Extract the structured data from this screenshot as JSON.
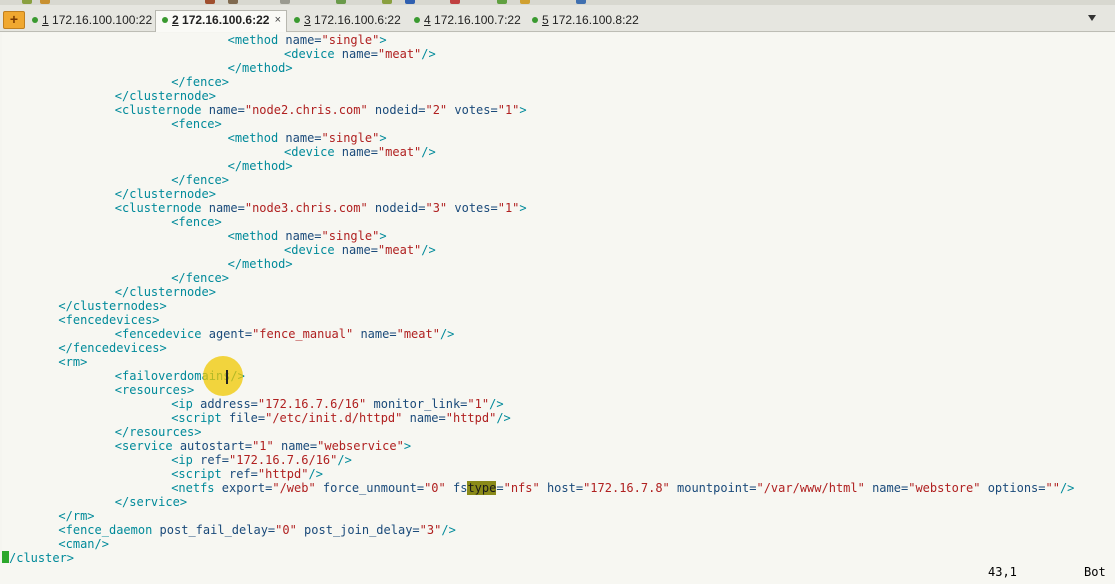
{
  "tabs": [
    {
      "num": "1",
      "host": "172.16.100.100:22"
    },
    {
      "num": "2",
      "host": "172.16.100.6:22"
    },
    {
      "num": "3",
      "host": "172.16.100.6:22"
    },
    {
      "num": "4",
      "host": "172.16.100.7:22"
    },
    {
      "num": "5",
      "host": "172.16.100.8:22"
    }
  ],
  "tab_close_glyph": "×",
  "tab_add_glyph": "+",
  "lines": [
    {
      "indent": 32,
      "parts": [
        [
          "t",
          "<method "
        ],
        [
          "a",
          "name="
        ],
        [
          "v",
          "\"single\""
        ],
        [
          "t",
          ">"
        ]
      ]
    },
    {
      "indent": 40,
      "parts": [
        [
          "t",
          "<device "
        ],
        [
          "a",
          "name="
        ],
        [
          "v",
          "\"meat\""
        ],
        [
          "t",
          "/>"
        ]
      ]
    },
    {
      "indent": 32,
      "parts": [
        [
          "t",
          "</method>"
        ]
      ]
    },
    {
      "indent": 24,
      "parts": [
        [
          "t",
          "</fence>"
        ]
      ]
    },
    {
      "indent": 16,
      "parts": [
        [
          "t",
          "</clusternode>"
        ]
      ]
    },
    {
      "indent": 16,
      "parts": [
        [
          "t",
          "<clusternode "
        ],
        [
          "a",
          "name="
        ],
        [
          "v",
          "\"node2.chris.com\""
        ],
        [
          "a",
          " nodeid="
        ],
        [
          "v",
          "\"2\""
        ],
        [
          "a",
          " votes="
        ],
        [
          "v",
          "\"1\""
        ],
        [
          "t",
          ">"
        ]
      ]
    },
    {
      "indent": 24,
      "parts": [
        [
          "t",
          "<fence>"
        ]
      ]
    },
    {
      "indent": 32,
      "parts": [
        [
          "t",
          "<method "
        ],
        [
          "a",
          "name="
        ],
        [
          "v",
          "\"single\""
        ],
        [
          "t",
          ">"
        ]
      ]
    },
    {
      "indent": 40,
      "parts": [
        [
          "t",
          "<device "
        ],
        [
          "a",
          "name="
        ],
        [
          "v",
          "\"meat\""
        ],
        [
          "t",
          "/>"
        ]
      ]
    },
    {
      "indent": 32,
      "parts": [
        [
          "t",
          "</method>"
        ]
      ]
    },
    {
      "indent": 24,
      "parts": [
        [
          "t",
          "</fence>"
        ]
      ]
    },
    {
      "indent": 16,
      "parts": [
        [
          "t",
          "</clusternode>"
        ]
      ]
    },
    {
      "indent": 16,
      "parts": [
        [
          "t",
          "<clusternode "
        ],
        [
          "a",
          "name="
        ],
        [
          "v",
          "\"node3.chris.com\""
        ],
        [
          "a",
          " nodeid="
        ],
        [
          "v",
          "\"3\""
        ],
        [
          "a",
          " votes="
        ],
        [
          "v",
          "\"1\""
        ],
        [
          "t",
          ">"
        ]
      ]
    },
    {
      "indent": 24,
      "parts": [
        [
          "t",
          "<fence>"
        ]
      ]
    },
    {
      "indent": 32,
      "parts": [
        [
          "t",
          "<method "
        ],
        [
          "a",
          "name="
        ],
        [
          "v",
          "\"single\""
        ],
        [
          "t",
          ">"
        ]
      ]
    },
    {
      "indent": 40,
      "parts": [
        [
          "t",
          "<device "
        ],
        [
          "a",
          "name="
        ],
        [
          "v",
          "\"meat\""
        ],
        [
          "t",
          "/>"
        ]
      ]
    },
    {
      "indent": 32,
      "parts": [
        [
          "t",
          "</method>"
        ]
      ]
    },
    {
      "indent": 24,
      "parts": [
        [
          "t",
          "</fence>"
        ]
      ]
    },
    {
      "indent": 16,
      "parts": [
        [
          "t",
          "</clusternode>"
        ]
      ]
    },
    {
      "indent": 8,
      "parts": [
        [
          "t",
          "</clusternodes>"
        ]
      ]
    },
    {
      "indent": 8,
      "parts": [
        [
          "t",
          "<fencedevices>"
        ]
      ]
    },
    {
      "indent": 16,
      "parts": [
        [
          "t",
          "<fencedevice "
        ],
        [
          "a",
          "agent="
        ],
        [
          "v",
          "\"fence_manual\""
        ],
        [
          "a",
          " name="
        ],
        [
          "v",
          "\"meat\""
        ],
        [
          "t",
          "/>"
        ]
      ]
    },
    {
      "indent": 8,
      "parts": [
        [
          "t",
          "</fencedevices>"
        ]
      ]
    },
    {
      "indent": 8,
      "parts": [
        [
          "t",
          "<rm>"
        ]
      ]
    },
    {
      "indent": 16,
      "parts": [
        [
          "t",
          "<failoverdomains/>"
        ]
      ]
    },
    {
      "indent": 16,
      "parts": [
        [
          "t",
          "<resources>"
        ]
      ]
    },
    {
      "indent": 24,
      "parts": [
        [
          "t",
          "<ip "
        ],
        [
          "a",
          "address="
        ],
        [
          "v",
          "\"172.16.7.6/16\""
        ],
        [
          "a",
          " monitor_link="
        ],
        [
          "v",
          "\"1\""
        ],
        [
          "t",
          "/>"
        ]
      ]
    },
    {
      "indent": 24,
      "parts": [
        [
          "t",
          "<script "
        ],
        [
          "a",
          "file="
        ],
        [
          "v",
          "\"/etc/init.d/httpd\""
        ],
        [
          "a",
          " name="
        ],
        [
          "v",
          "\"httpd\""
        ],
        [
          "t",
          "/>"
        ]
      ]
    },
    {
      "indent": 16,
      "parts": [
        [
          "t",
          "</resources>"
        ]
      ]
    },
    {
      "indent": 16,
      "parts": [
        [
          "t",
          "<service "
        ],
        [
          "a",
          "autostart="
        ],
        [
          "v",
          "\"1\""
        ],
        [
          "a",
          " name="
        ],
        [
          "v",
          "\"webservice\""
        ],
        [
          "t",
          ">"
        ]
      ]
    },
    {
      "indent": 24,
      "parts": [
        [
          "t",
          "<ip "
        ],
        [
          "a",
          "ref="
        ],
        [
          "v",
          "\"172.16.7.6/16\""
        ],
        [
          "t",
          "/>"
        ]
      ]
    },
    {
      "indent": 24,
      "parts": [
        [
          "t",
          "<script "
        ],
        [
          "a",
          "ref="
        ],
        [
          "v",
          "\"httpd\""
        ],
        [
          "t",
          "/>"
        ]
      ]
    },
    {
      "indent": 24,
      "parts": [
        [
          "t",
          "<netfs "
        ],
        [
          "a",
          "export="
        ],
        [
          "v",
          "\"/web\""
        ],
        [
          "a",
          " force_unmount="
        ],
        [
          "v",
          "\"0\""
        ],
        [
          "a",
          " fs"
        ],
        [
          "h",
          "type"
        ],
        [
          "a",
          "="
        ],
        [
          "v",
          "\"nfs\""
        ],
        [
          "a",
          " host="
        ],
        [
          "v",
          "\"172.16.7.8\""
        ],
        [
          "a",
          " mountpoint="
        ],
        [
          "v",
          "\"/var/www/html\""
        ],
        [
          "a",
          " name="
        ],
        [
          "v",
          "\"webstore\""
        ],
        [
          "a",
          " options="
        ],
        [
          "v",
          "\"\""
        ],
        [
          "t",
          "/>"
        ]
      ]
    },
    {
      "indent": 16,
      "parts": [
        [
          "t",
          "</service>"
        ]
      ]
    },
    {
      "indent": 8,
      "parts": [
        [
          "t",
          "</rm>"
        ]
      ]
    },
    {
      "indent": 8,
      "parts": [
        [
          "t",
          "<fence_daemon "
        ],
        [
          "a",
          "post_fail_delay="
        ],
        [
          "v",
          "\"0\""
        ],
        [
          "a",
          " post_join_delay="
        ],
        [
          "v",
          "\"3\""
        ],
        [
          "t",
          "/>"
        ]
      ]
    },
    {
      "indent": 8,
      "parts": [
        [
          "t",
          "<cman/>"
        ]
      ]
    },
    {
      "indent": 0,
      "cursor": true,
      "parts": [
        [
          "t",
          "/cluster>"
        ]
      ]
    }
  ],
  "status": {
    "position": "43,1",
    "scroll": "Bot"
  }
}
